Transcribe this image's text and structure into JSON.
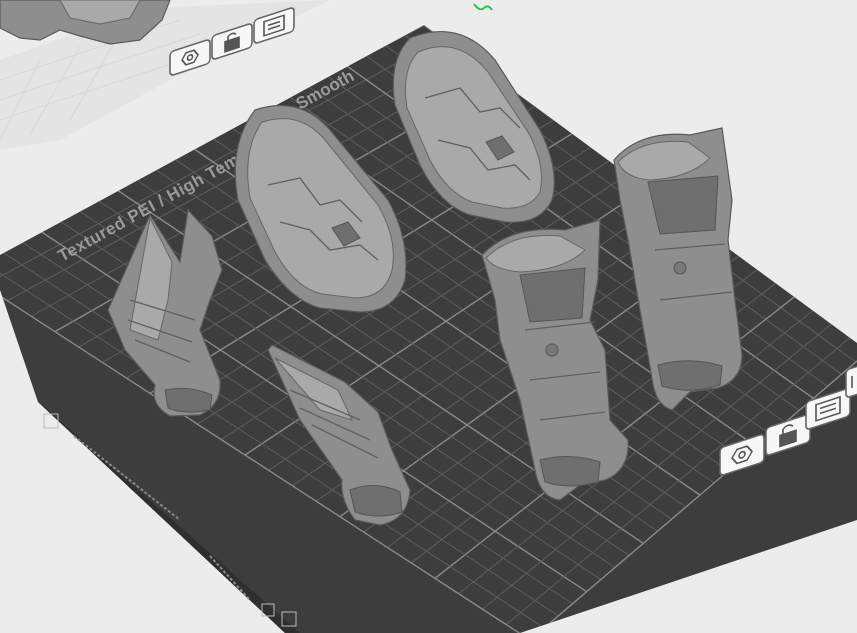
{
  "plate": {
    "label_line_1": "Smooth",
    "label_line_2": "Textured PEI / High Temp Plate",
    "colors": {
      "background": "#ececec",
      "plate": "#3d3d3d",
      "grid": "#6b6b6b",
      "models": "#8e8e8e",
      "axis_marker": "#21c84a"
    }
  },
  "icons": {
    "top_plate": [
      "settings-hex-icon",
      "lock-icon",
      "arrange-icon"
    ],
    "bottom_plate": [
      "settings-hex-icon",
      "lock-icon",
      "arrange-icon",
      "more-icon"
    ]
  },
  "models": [
    "left-gauntlet",
    "front-gauntlet",
    "left-shin-plate",
    "right-shin-plate",
    "middle-boot",
    "right-boot"
  ]
}
